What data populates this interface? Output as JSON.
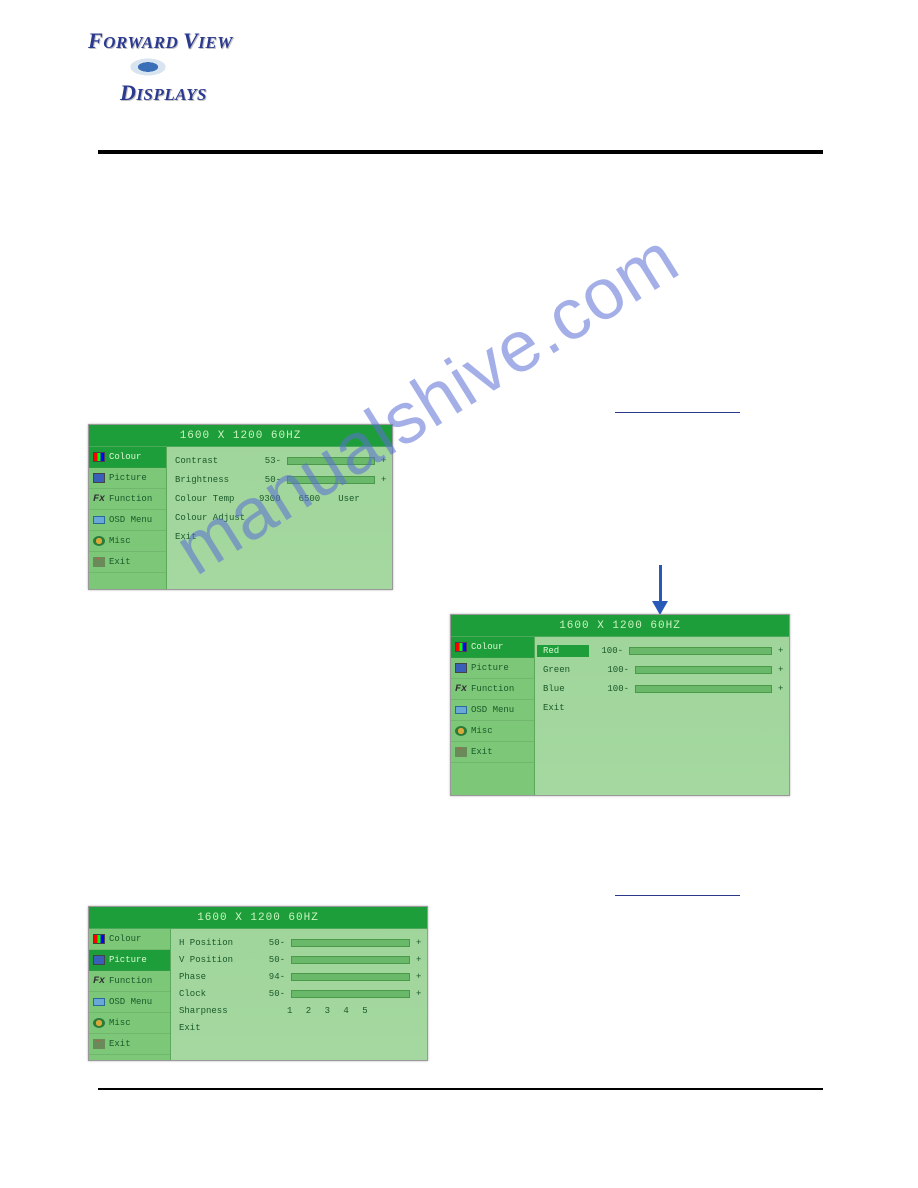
{
  "logo": {
    "line1_word1": "FORWARD",
    "line1_word2": "VIEW",
    "line2": "DISPLAYS"
  },
  "watermark": "manualshive.com",
  "osd_menu": {
    "items": [
      {
        "label": "Colour"
      },
      {
        "label": "Picture"
      },
      {
        "label": "Function"
      },
      {
        "label": "OSD Menu"
      },
      {
        "label": "Misc"
      },
      {
        "label": "Exit"
      }
    ]
  },
  "osd1": {
    "header": "1600 X 1200   60HZ",
    "rows": {
      "contrast_label": "Contrast",
      "contrast_val": "53-",
      "brightness_label": "Brightness",
      "brightness_val": "50-",
      "colourtemp_label": "Colour Temp",
      "ct_9300": "9300",
      "ct_6500": "6500",
      "ct_user": "User",
      "colouradjust": "Colour Adjust",
      "exit": "Exit"
    }
  },
  "osd2": {
    "header": "1600 X 1200   60HZ",
    "red_label": "Red",
    "red_val": "100-",
    "green_label": "Green",
    "green_val": "100-",
    "blue_label": "Blue",
    "blue_val": "100-",
    "exit": "Exit"
  },
  "osd3": {
    "header": "1600 X 1200   60HZ",
    "hpos_label": "H Position",
    "hpos_val": "50-",
    "vpos_label": "V Position",
    "vpos_val": "50-",
    "phase_label": "Phase",
    "phase_val": "94-",
    "clock_label": "Clock",
    "clock_val": "50-",
    "sharp_label": "Sharpness",
    "sharp_vals": "1 2 3 4 5",
    "exit": "Exit"
  }
}
